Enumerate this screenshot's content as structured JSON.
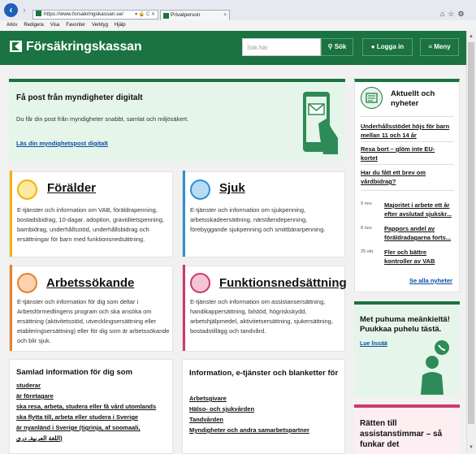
{
  "browser": {
    "url": "https://www.forsakringskassan.se/",
    "tab_title": "Privatperson",
    "menu": [
      "Arkiv",
      "Redigera",
      "Visa",
      "Favoriter",
      "Verktyg",
      "Hjälp"
    ]
  },
  "header": {
    "logo": "Försäkringskassan",
    "search_placeholder": "Sök här",
    "search_button": "Sök",
    "login_button": "Logga in",
    "menu_button": "Meny"
  },
  "promo": {
    "title": "Få post från myndigheter digitalt",
    "body": "Du får din post från myndigheter snabbt, samlat och miljösäkert.",
    "link": "Läs din myndighetspost digitalt"
  },
  "cards": [
    {
      "title": "Förälder",
      "body": "E-tjänster och information om VAB, föräldrapenning, bostadsbidrag, 10-dagar, adoption, graviditetspenning, barnbidrag, underhållsstöd, underhållsbidrag och ersättningar för barn med funktionsnedsättning.",
      "color": "#f0b400"
    },
    {
      "title": "Sjuk",
      "body": "E-tjänster och information om sjukpenning, arbetsskadeersättning, närståendepenning, förebyggande sjukpenning och smittbärarpenning.",
      "color": "#2f8fd0"
    },
    {
      "title": "Arbetssökande",
      "body": "E-tjänster och information för dig som deltar i Arbetsförmedlingens program och ska ansöka om ersättning (aktivitetsstöd, utvecklingsersättning eller etableringsersättning) eller för dig som är arbetssökande och blir sjuk.",
      "color": "#e8812a"
    },
    {
      "title": "Funktionsnedsättning",
      "body": "E-tjänster och information om assistansersättning, handikappersättning, bilstöd, högriskskydd, arbetshjälpmedel, aktivitetsersättning, sjukersättning, bostadstillägg och tandvård.",
      "color": "#cc3a6a"
    }
  ],
  "samlad": {
    "title": "Samlad information för dig som",
    "items": [
      "studerar",
      "är företagare",
      "ska resa, arbeta, studera eller få vård utomlands",
      "ska flytta till, arbeta eller studera i Sverige",
      "är nyanländ i Sverige (tigrinja, af soomaali,",
      "اللغة العربية, دری)"
    ]
  },
  "etjanster": {
    "title": "Information, e-tjänster och blanketter för",
    "items": [
      "Arbetsgivare",
      "Hälso- och sjukvården",
      "Tandvården",
      "Myndigheter och andra samarbetspartner"
    ]
  },
  "news": {
    "title": "Aktuellt och nyheter",
    "items": [
      "Underhållsstödet höjs för barn mellan 11 och 14 år",
      "Resa bort – glöm inte EU-kortet",
      "Har du fått ett brev om vårdbidrag?"
    ],
    "dated": [
      {
        "date": "9 nov.",
        "text": "Majoritet i arbete ett år efter avslutad sjukskr..."
      },
      {
        "date": "8 nov.",
        "text": "Pappors andel av föräldradagarna forts..."
      },
      {
        "date": "25 okt.",
        "text": "Fler och bättre kontroller av VAB"
      }
    ],
    "all_link": "Se alla nyheter"
  },
  "meankieli": {
    "title": "Met puhuma meänkieltä! Puukkaa puhelu tästä.",
    "link": "Lue lissää"
  },
  "ratten": {
    "title": "Rätten till assistanstimmar – så funkar det"
  }
}
